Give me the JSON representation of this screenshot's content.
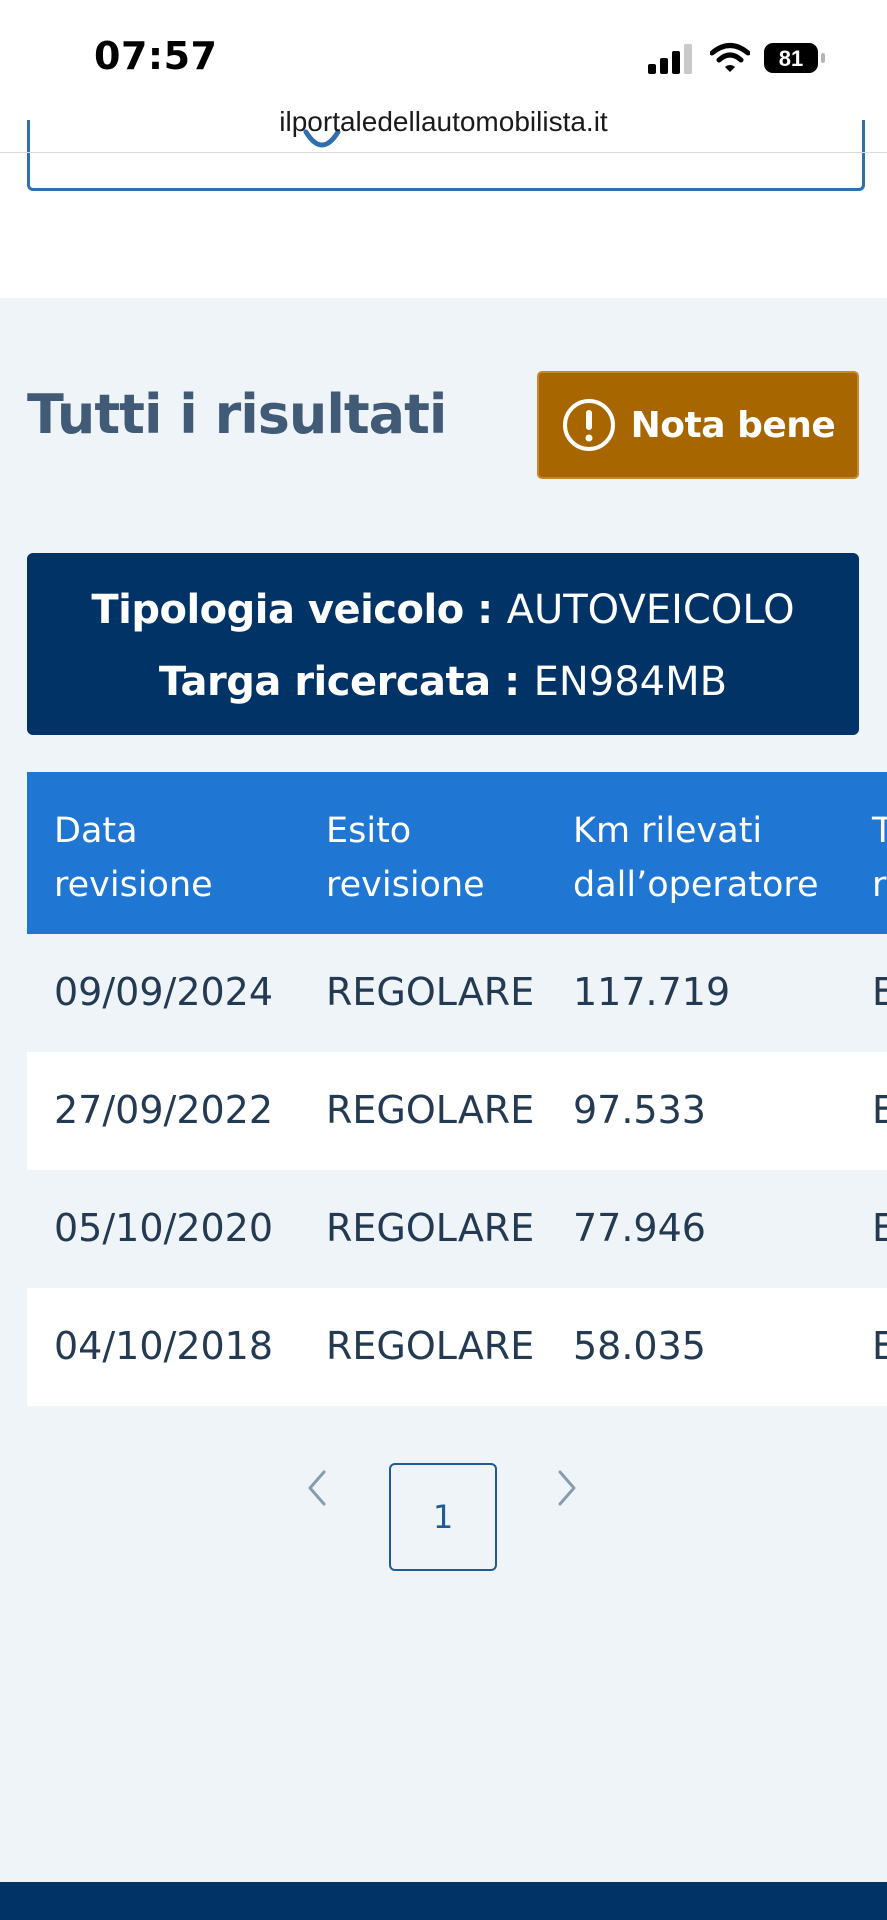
{
  "status_bar": {
    "time": "07:57",
    "battery": "81"
  },
  "browser": {
    "url": "ilportaledellautomobilista.it"
  },
  "results": {
    "title": "Tutti i risultati",
    "note_button": "Nota bene"
  },
  "vehicle": {
    "type_label": "Tipologia veicolo :",
    "type_value": "AUTOVEICOLO",
    "plate_label": "Targa ricercata :",
    "plate_value": "EN984MB"
  },
  "table": {
    "headers": [
      [
        "Data",
        "revisione"
      ],
      [
        "Esito",
        "revisione"
      ],
      [
        "Km rilevati",
        "dall’operatore"
      ],
      [
        "T",
        "r"
      ]
    ],
    "rows": [
      [
        "09/09/2024",
        "REGOLARE",
        "117.719",
        "E"
      ],
      [
        "27/09/2022",
        "REGOLARE",
        "97.533",
        "E"
      ],
      [
        "05/10/2020",
        "REGOLARE",
        "77.946",
        "E"
      ],
      [
        "04/10/2018",
        "REGOLARE",
        "58.035",
        "E"
      ]
    ]
  },
  "pagination": {
    "current_page": "1"
  },
  "colors": {
    "primary_dark": "#013366",
    "table_header": "#2076d3",
    "warning": "#a86600",
    "section_bg": "#eff4f9"
  }
}
